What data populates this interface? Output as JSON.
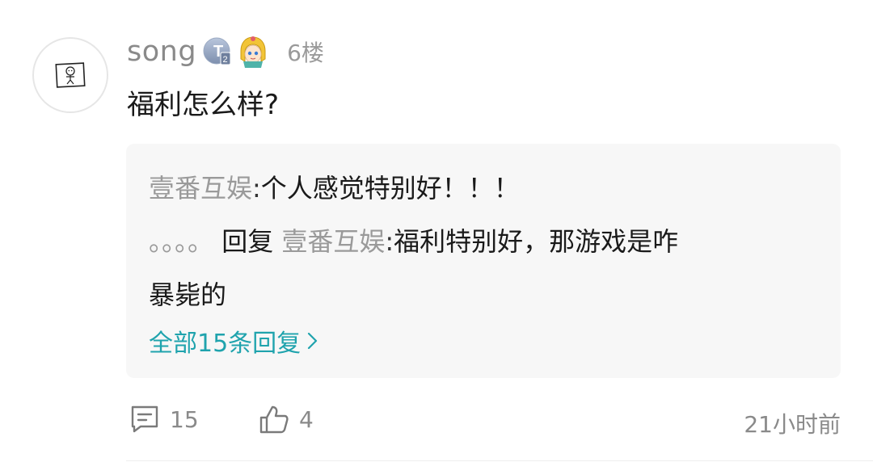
{
  "comment": {
    "username": "song",
    "floor": "6楼",
    "text": "福利怎么样?",
    "badges": [
      "t2-level-badge",
      "cartoon-avatar-badge"
    ]
  },
  "replies": [
    {
      "user": "壹番互娱",
      "separator": ":",
      "text": "个人感觉特别好！！！"
    },
    {
      "user": "。。。。",
      "reply_word": "回复",
      "target": "壹番互娱",
      "separator": ":",
      "text_line1": "福利特别好，那游戏是咋",
      "text_line2": "暴毙的"
    }
  ],
  "more_replies": "全部15条回复",
  "footer": {
    "comment_count": "15",
    "like_count": "4",
    "time": "21小时前"
  },
  "colors": {
    "link": "#1fa3ad",
    "muted": "#9a9a9a",
    "reply_bg": "#f7f7f7"
  }
}
